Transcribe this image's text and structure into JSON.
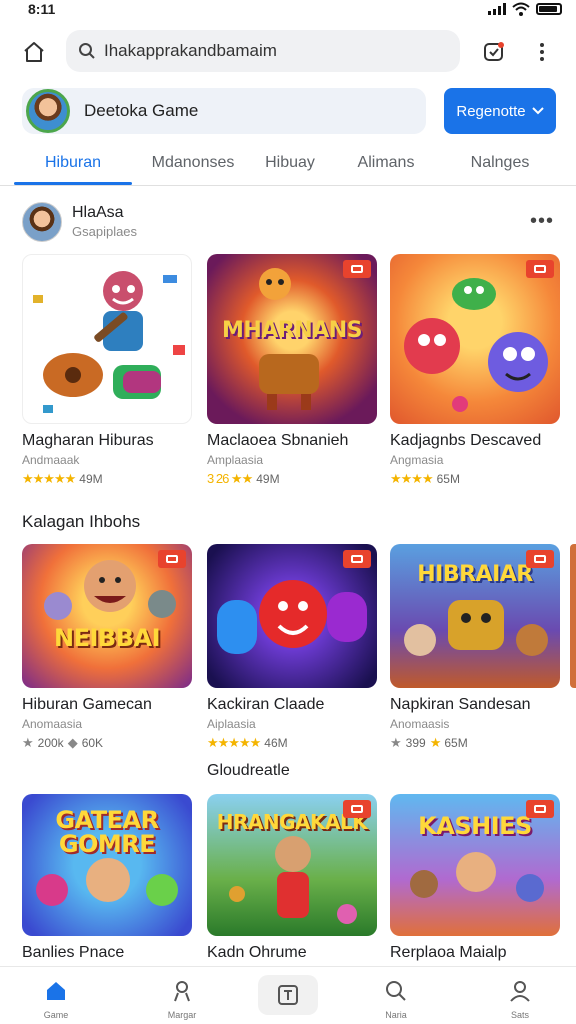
{
  "status": {
    "time": "8:11"
  },
  "search": {
    "value": "Ihakapprakandbamaim"
  },
  "account": {
    "name": "Deetoka Game"
  },
  "region_button": {
    "label": "Regenotte"
  },
  "tabs": [
    {
      "label": "Hiburan",
      "active": true
    },
    {
      "label": "Mdanonses"
    },
    {
      "label": "Hibuay"
    },
    {
      "label": "Alimans"
    },
    {
      "label": "Nalnges"
    }
  ],
  "developer": {
    "name": "HlaAsa",
    "sub": "Gsapiplaes"
  },
  "row1": [
    {
      "title": "Magharan Hiburas",
      "sub": "Andmaaak",
      "rating_text": "★★★★★",
      "count": "49M",
      "art_text": ""
    },
    {
      "title": "Maclaoea Sbnanieh",
      "sub": "Amplaasia",
      "rating_text": "3 26 ★★",
      "count": "49M",
      "art_text": "MHARNANS"
    },
    {
      "title": "Kadjagnbs Descaved",
      "sub": "Angmasia",
      "rating_text": "★★★★",
      "count": "65M",
      "art_text": ""
    }
  ],
  "section2": {
    "title": "Kalagan Ihbohs"
  },
  "row2": [
    {
      "title": "Hiburan Gamecan",
      "sub": "Anomaasia",
      "rating_text": "200k",
      "count": "60K",
      "art_text": "NEIBBAI"
    },
    {
      "title": "Kackiran Claade",
      "sub": "Aiplaasia",
      "rating_text": "★★★★★",
      "count": "46M",
      "art_text": ""
    },
    {
      "title": "Napkiran Sandesan",
      "sub": "Anomaasis",
      "rating_text": "399",
      "count": "65M",
      "art_text": "HIBRAIAR"
    }
  ],
  "section3": {
    "title": "Gloudreatle"
  },
  "row3": [
    {
      "title": "Banlies Pnace",
      "art_text": "GATEAR GOMRE"
    },
    {
      "title": "Kadn Ohrume",
      "art_text": "HRANGAKALK"
    },
    {
      "title": "Rerplaoa Maialp",
      "art_text": "KASHIES"
    }
  ],
  "bottom_nav": [
    {
      "label": "Game",
      "icon": "home-icon"
    },
    {
      "label": "Margar",
      "icon": "person-icon"
    },
    {
      "label": "",
      "icon": "square-icon"
    },
    {
      "label": "Naria",
      "icon": "search-icon"
    },
    {
      "label": "Sats",
      "icon": "account-icon"
    }
  ],
  "colors": {
    "accent": "#1a73e8",
    "badge": "#e8432d",
    "star": "#f4b400"
  }
}
